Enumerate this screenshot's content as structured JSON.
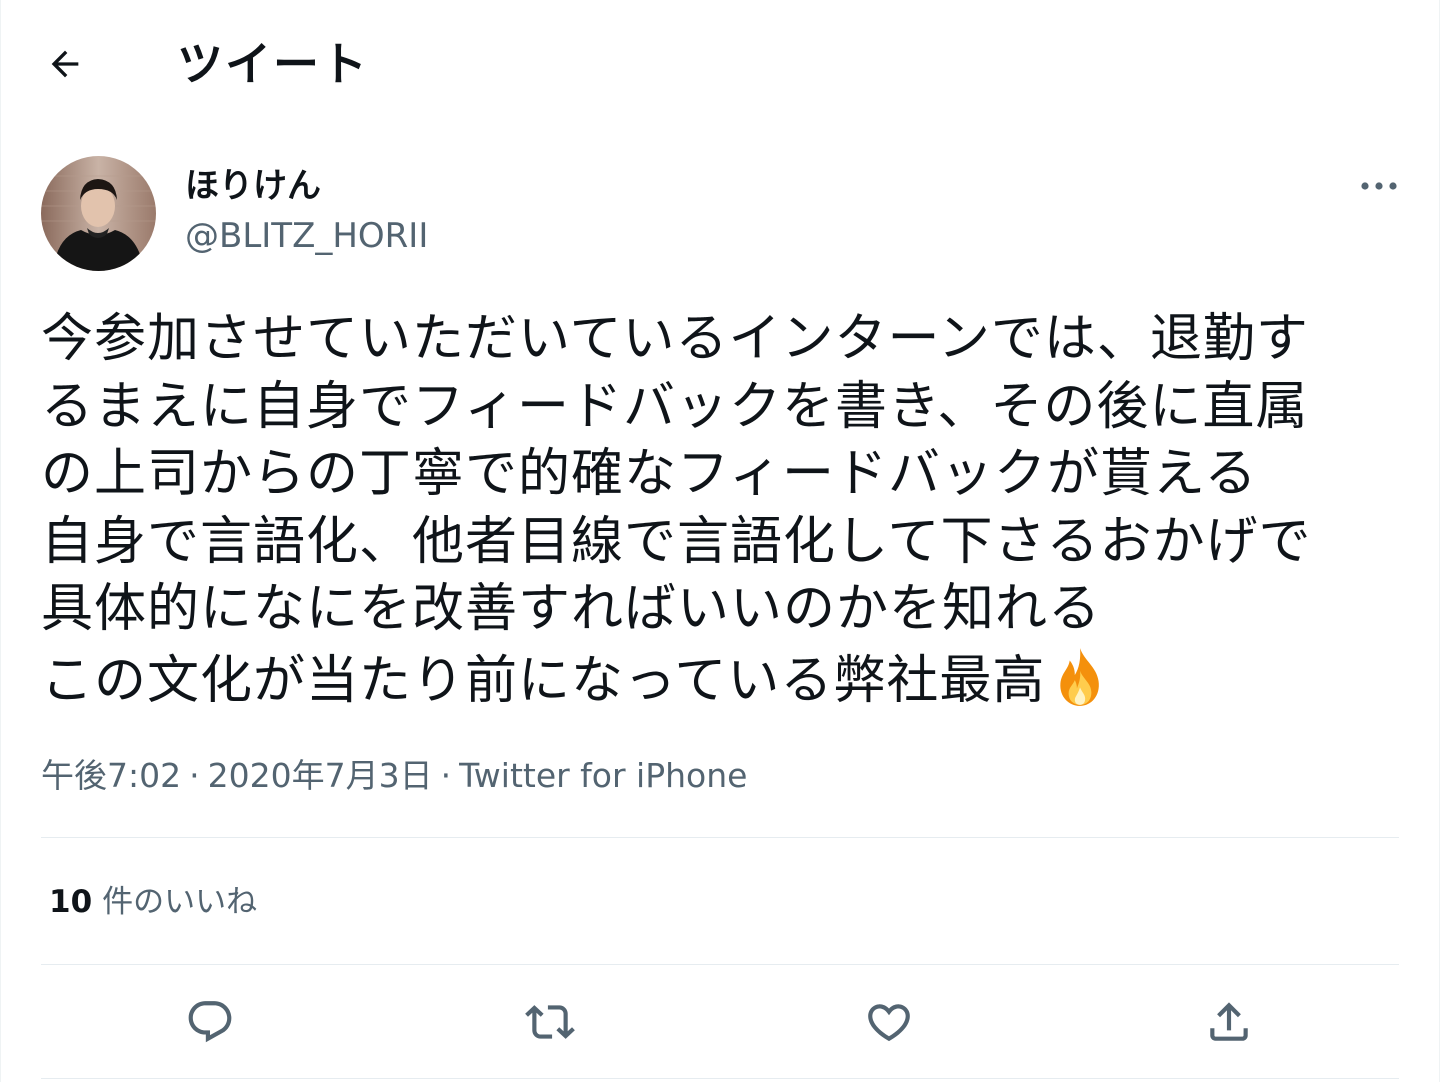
{
  "header": {
    "title": "ツイート",
    "back_icon": "arrow-left-icon"
  },
  "author": {
    "display_name": "ほりけん",
    "handle": "@BLITZ_HORII",
    "avatar_icon": "avatar-photo",
    "more_icon": "more-horizontal-icon"
  },
  "tweet": {
    "lines": [
      "今参加させていただいているインターンでは、退勤す",
      "るまえに自身でフィードバックを書き、その後に直属",
      "の上司からの丁寧で的確なフィードバックが貰える",
      "自身で言語化、他者目線で言語化して下さるおかげで",
      "具体的になにを改善すればいいのかを知れる",
      "この文化が当たり前になっている弊社最高"
    ],
    "emoji_icon": "fire-emoji-icon"
  },
  "meta": {
    "time": "午後7:02",
    "date": "2020年7月3日",
    "source": "Twitter for iPhone",
    "separator": "·"
  },
  "likes": {
    "count": "10",
    "label": "件のいいね"
  },
  "actions": [
    {
      "name": "reply",
      "icon": "reply-icon"
    },
    {
      "name": "retweet",
      "icon": "retweet-icon"
    },
    {
      "name": "like",
      "icon": "heart-icon"
    },
    {
      "name": "share",
      "icon": "share-icon"
    }
  ],
  "colors": {
    "text": "#0f1419",
    "secondary": "#536471",
    "divider": "#e6ecf0",
    "icon": "#536471"
  }
}
